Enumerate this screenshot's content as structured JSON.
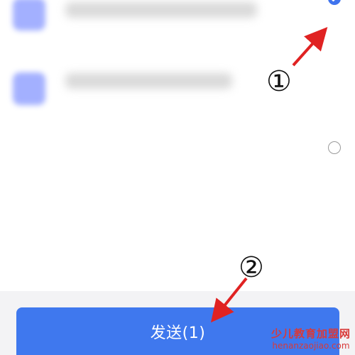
{
  "send_button": {
    "label": "发送(1)"
  },
  "annotations": {
    "step1": "①",
    "step2": "②"
  },
  "list": {
    "items": [
      {
        "checked": true
      },
      {
        "checked": false
      }
    ]
  },
  "watermark": {
    "top": "少儿教育加盟网",
    "bottom": "henanzaojiao.com"
  },
  "colors": {
    "accent": "#3f78ee",
    "arrow": "#e02222",
    "watermark": "#d83a3a"
  },
  "icons": {
    "check": "check-icon"
  }
}
